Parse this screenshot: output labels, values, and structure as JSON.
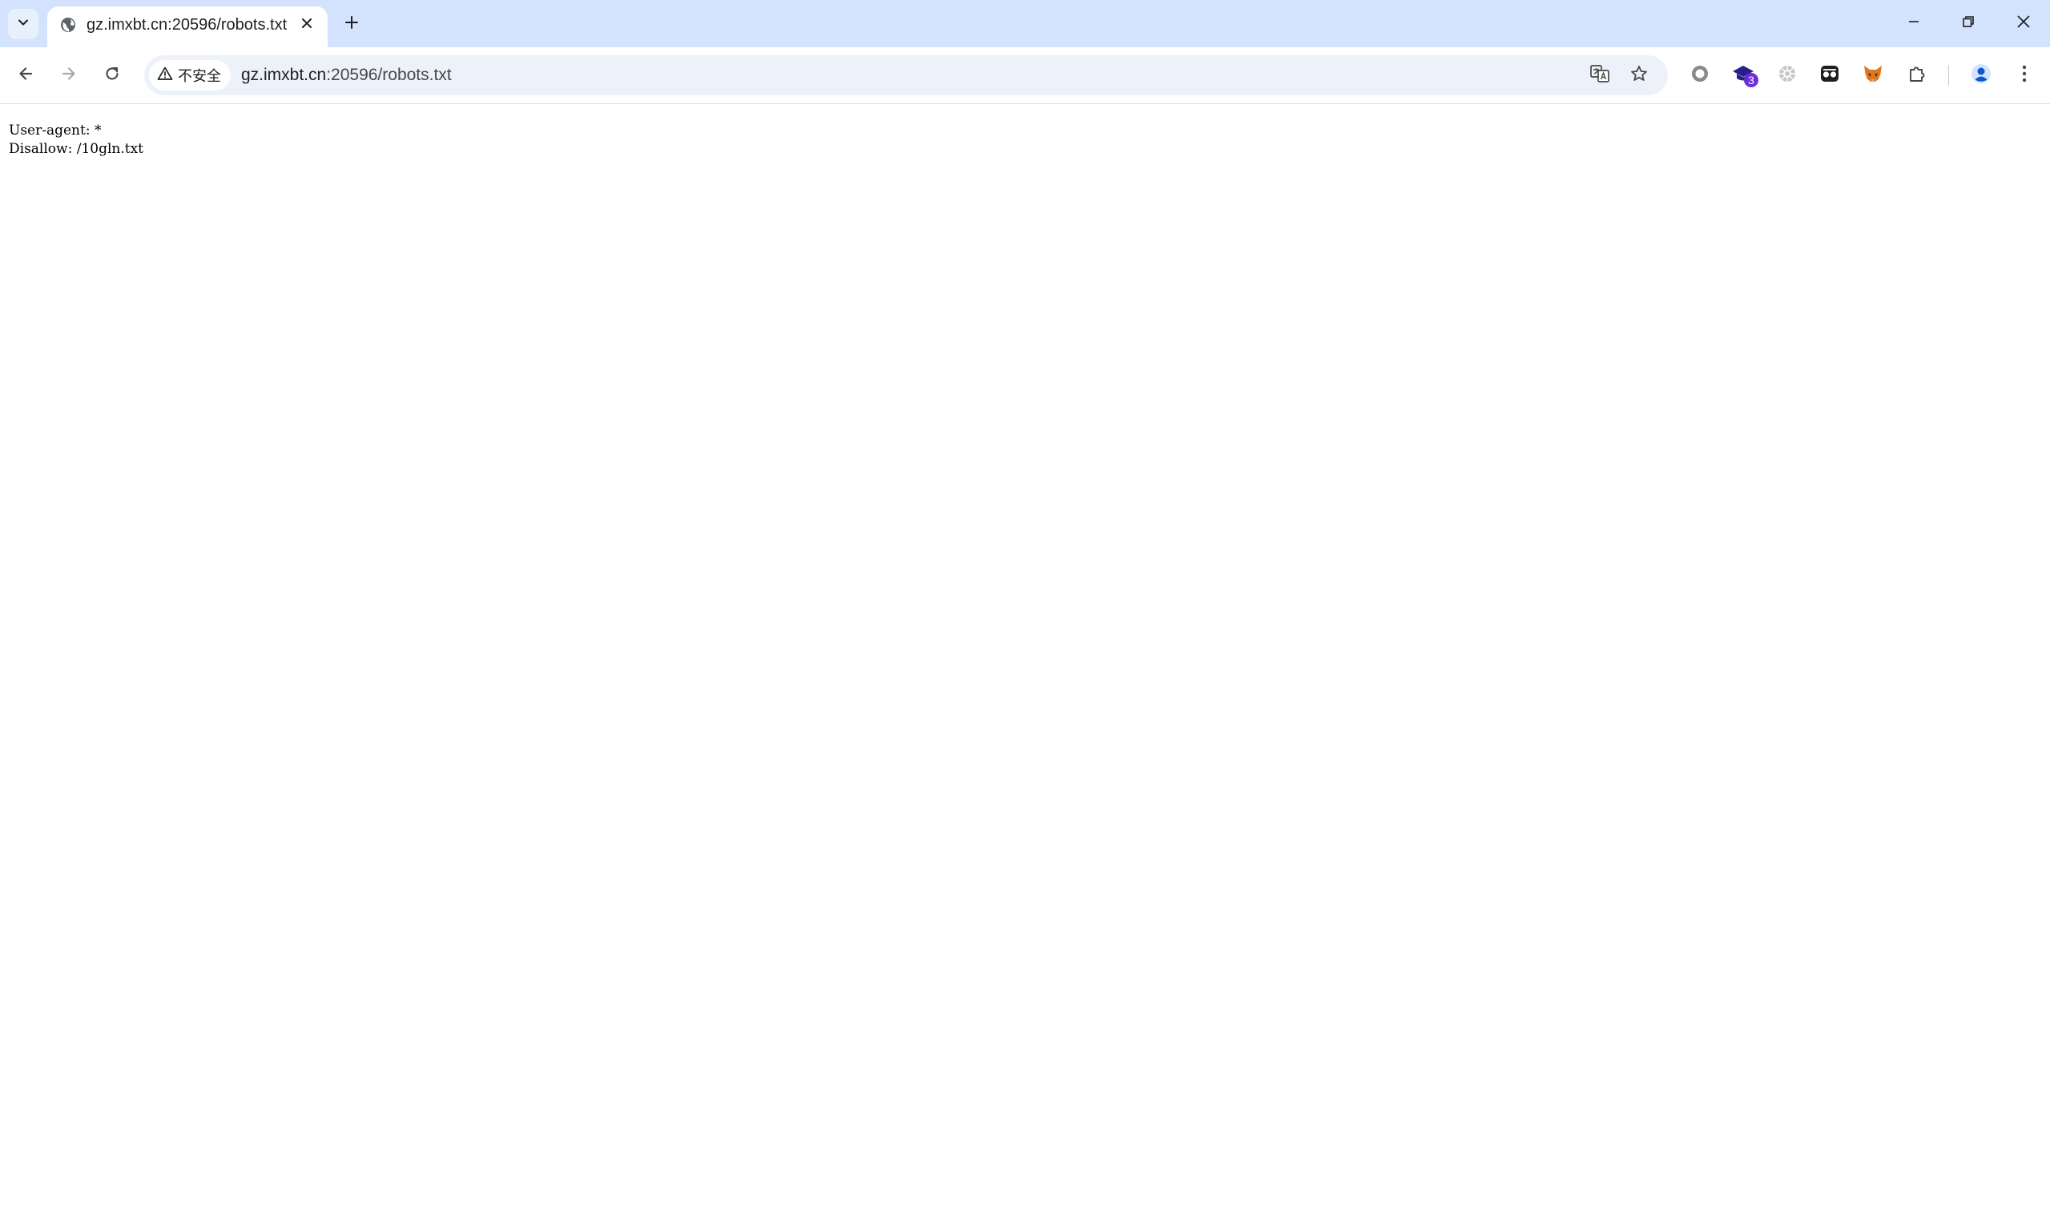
{
  "browser": {
    "tab": {
      "title": "gz.imxbt.cn:20596/robots.txt"
    },
    "address_bar": {
      "security_label": "不安全",
      "url_host": "gz.imxbt.cn",
      "url_rest": ":20596/robots.txt"
    },
    "extensions": {
      "badge_count": "3"
    },
    "colors": {
      "tab_strip": "#d3e3fd",
      "omnibox": "#edf2fa",
      "icon": "#474747",
      "badge": "#6b2fd6"
    }
  },
  "page": {
    "lines": [
      "User-agent: *",
      "Disallow: /10gln.txt"
    ]
  }
}
